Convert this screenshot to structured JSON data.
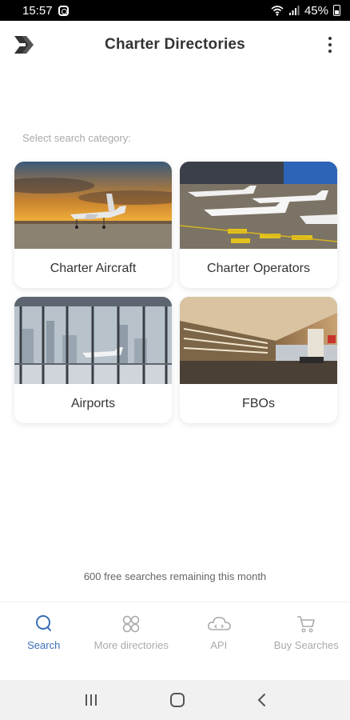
{
  "status": {
    "time": "15:57",
    "battery": "45%"
  },
  "app_bar": {
    "title": "Charter Directories"
  },
  "section_label": "Select search category:",
  "categories": [
    {
      "label": "Charter Aircraft"
    },
    {
      "label": "Charter Operators"
    },
    {
      "label": "Airports"
    },
    {
      "label": "FBOs"
    }
  ],
  "free_searches": "600 free searches remaining this month",
  "bottom_nav": [
    {
      "label": "Search",
      "icon": "search-icon",
      "active": true
    },
    {
      "label": "More directories",
      "icon": "grid-icon",
      "active": false
    },
    {
      "label": "API",
      "icon": "cloud-icon",
      "active": false
    },
    {
      "label": "Buy Searches",
      "icon": "cart-icon",
      "active": false
    }
  ],
  "colors": {
    "accent": "#3a6fb5",
    "muted": "#aaaaaa",
    "title": "#333333"
  }
}
